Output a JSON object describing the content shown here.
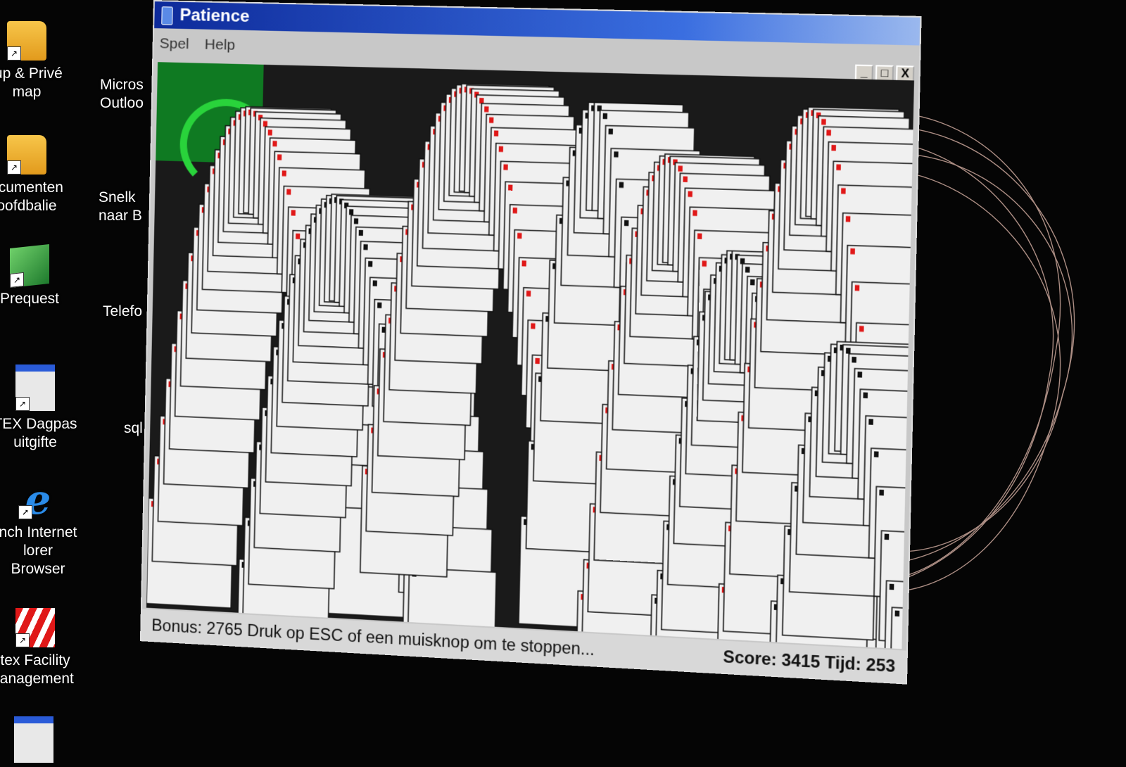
{
  "desktop": {
    "icons_left": [
      {
        "label_line1": "lup & Privé",
        "label_line2": "map",
        "icon": "folder-icon"
      },
      {
        "label_line1": "ocumenten",
        "label_line2": "oofdbalie",
        "icon": "folder-icon"
      },
      {
        "label_line1": "Prequest",
        "label_line2": "",
        "icon": "cube-app-icon"
      },
      {
        "label_line1": "TEX Dagpas",
        "label_line2": "uitgifte",
        "icon": "window-app-icon"
      },
      {
        "label_line1": "nch Internet",
        "label_line2": "lorer Browser",
        "icon": "internet-explorer-icon"
      },
      {
        "label_line1": "tex Facility",
        "label_line2": "lanagement",
        "icon": "facility-app-icon"
      }
    ],
    "icons_second": [
      {
        "label_line1": "Micros",
        "label_line2": "Outloo"
      },
      {
        "label_line1": "Snelk",
        "label_line2": "naar B"
      },
      {
        "label_line1": "Telefo",
        "label_line2": ""
      },
      {
        "label_line1": "sql",
        "label_line2": ""
      }
    ]
  },
  "window": {
    "title": "Patience",
    "menu": [
      "Spel",
      "Help"
    ],
    "controls": {
      "minimize": "_",
      "maximize": "□",
      "close": "X"
    }
  },
  "status": {
    "left": "Bonus: 2765  Druk op ESC of een muisknop om te stoppen...",
    "right": "Score: 3415 Tijd: 253"
  },
  "colors": {
    "card_red": "#e01818",
    "card_black": "#111111",
    "card_face": "#f0f0f0",
    "felt_green": "#0f7a22",
    "title_blue": "#0d2a9a"
  }
}
